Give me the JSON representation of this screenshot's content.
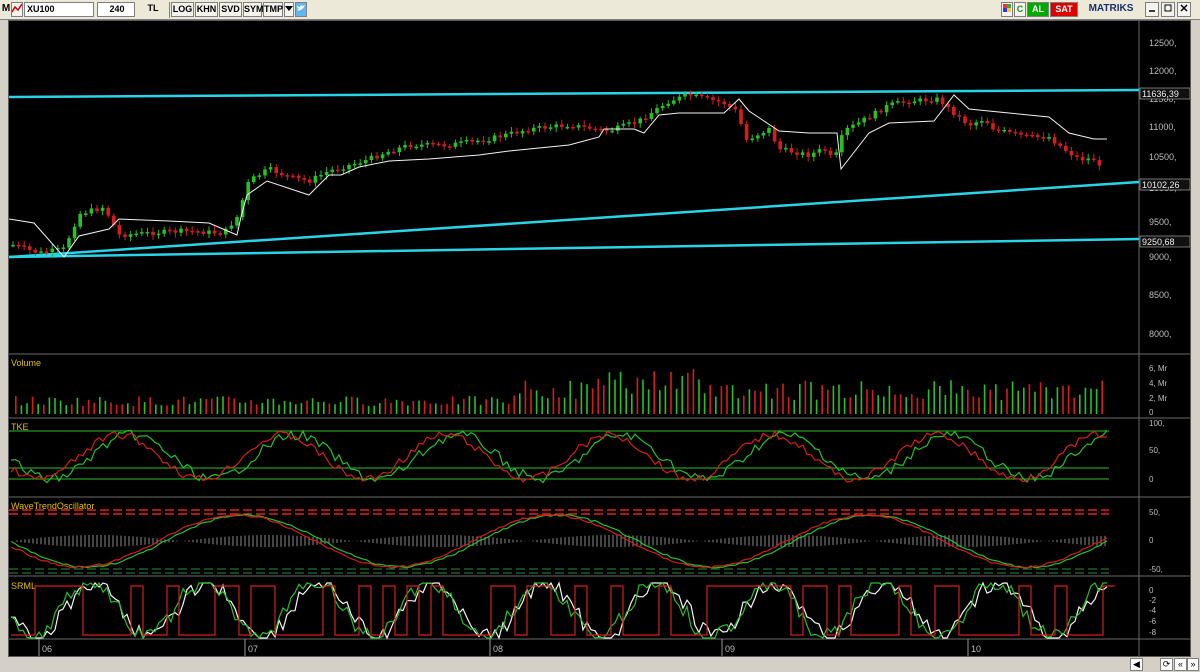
{
  "toolbar": {
    "menu_letter": "M",
    "symbol": "XU100",
    "period": "240",
    "currency": "TL",
    "log": "LOG",
    "khn": "KHN",
    "svd": "SVD",
    "sym": "SYM",
    "tmp": "TMP",
    "dropdown_icon": "triangle-down-icon",
    "twitter_icon": "bird-icon",
    "c_label": "C",
    "buy": "AL",
    "sell": "SAT",
    "brand": "MATRIKS"
  },
  "colors": {
    "up": "#27c027",
    "down": "#d61d1d",
    "trendline": "#2ad4e8",
    "panel_bg": "#000000",
    "axis": "#9a9a9a"
  },
  "price_panel": {
    "y_ticks": [
      "12500,",
      "12000,",
      "11500,",
      "11000,",
      "10500,",
      "10000,",
      "9500,",
      "9000,",
      "8500,",
      "8000,"
    ],
    "labels": [
      "11636,39",
      "10102,26",
      "9250,68"
    ]
  },
  "volume_panel": {
    "title": "Volume",
    "ticks": [
      "6, Mr",
      "4, Mr",
      "2, Mr",
      "0"
    ]
  },
  "tke_panel": {
    "title": "TKE",
    "ticks": [
      "100,",
      "50,",
      "0"
    ]
  },
  "wto_panel": {
    "title": "WaveTrendOscillator",
    "ticks": [
      "50,",
      "0",
      "-50,"
    ]
  },
  "srml_panel": {
    "title": "SRML",
    "ticks": [
      "0",
      "-2",
      "-4",
      "-6",
      "-8"
    ]
  },
  "x_axis": {
    "months": [
      "06",
      "07",
      "08",
      "09",
      "10"
    ]
  }
}
